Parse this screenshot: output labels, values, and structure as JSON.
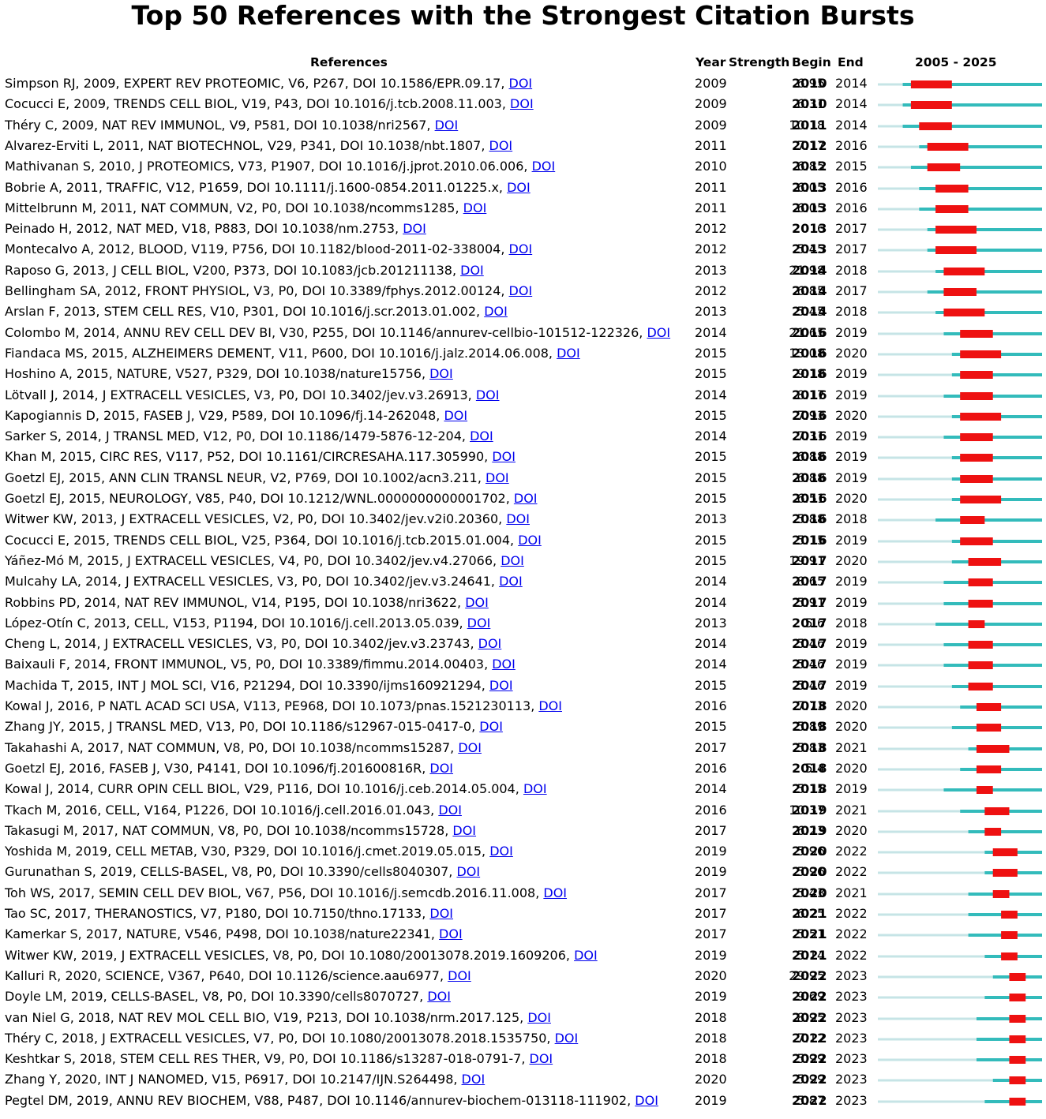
{
  "title": "Top 50 References with the Strongest Citation Bursts",
  "headers": {
    "references": "References",
    "year": "Year",
    "strength": "Strength",
    "begin": "Begin",
    "end": "End",
    "range": "2005 - 2025"
  },
  "colors": {
    "burst": "#ee1111",
    "cited": "#33bbbb",
    "before": "#c6e4e6"
  },
  "chart_data": {
    "type": "table",
    "timeline_range": [
      2005,
      2025
    ],
    "doi_label": "DOI",
    "rows": [
      {
        "ref": "Simpson RJ, 2009, EXPERT REV PROTEOMIC, V6, P267, DOI 10.1586/EPR.09.17, ",
        "year": "2009",
        "strength": "6.95",
        "begin": "2010",
        "end": "2014"
      },
      {
        "ref": "Cocucci E, 2009, TRENDS CELL BIOL, V19, P43, DOI 10.1016/j.tcb.2008.11.003, ",
        "year": "2009",
        "strength": "6.31",
        "begin": "2010",
        "end": "2014"
      },
      {
        "ref": "Théry C, 2009, NAT REV IMMUNOL, V9, P581, DOI 10.1038/nri2567, ",
        "year": "2009",
        "strength": "10.18",
        "begin": "2011",
        "end": "2014"
      },
      {
        "ref": "Alvarez-Erviti L, 2011, NAT BIOTECHNOL, V29, P341, DOI 10.1038/nbt.1807, ",
        "year": "2011",
        "strength": "7.17",
        "begin": "2012",
        "end": "2016"
      },
      {
        "ref": "Mathivanan S, 2010, J PROTEOMICS, V73, P1907, DOI 10.1016/j.jprot.2010.06.006, ",
        "year": "2010",
        "strength": "6.85",
        "begin": "2012",
        "end": "2015"
      },
      {
        "ref": "Bobrie A, 2011, TRAFFIC, V12, P1659, DOI 10.1111/j.1600-0854.2011.01225.x, ",
        "year": "2011",
        "strength": "6.05",
        "begin": "2013",
        "end": "2016"
      },
      {
        "ref": "Mittelbrunn M, 2011, NAT COMMUN, V2, P0, DOI 10.1038/ncomms1285, ",
        "year": "2011",
        "strength": "6.05",
        "begin": "2013",
        "end": "2016"
      },
      {
        "ref": "Peinado H, 2012, NAT MED, V18, P883, DOI 10.1038/nm.2753, ",
        "year": "2012",
        "strength": "6",
        "begin": "2013",
        "end": "2017"
      },
      {
        "ref": "Montecalvo A, 2012, BLOOD, V119, P756, DOI 10.1182/blood-2011-02-338004, ",
        "year": "2012",
        "strength": "5.45",
        "begin": "2013",
        "end": "2017"
      },
      {
        "ref": "Raposo G, 2013, J CELL BIOL, V200, P373, DOI 10.1083/jcb.201211138, ",
        "year": "2013",
        "strength": "21.98",
        "begin": "2014",
        "end": "2018"
      },
      {
        "ref": "Bellingham SA, 2012, FRONT PHYSIOL, V3, P0, DOI 10.3389/fphys.2012.00124, ",
        "year": "2012",
        "strength": "6.85",
        "begin": "2014",
        "end": "2017"
      },
      {
        "ref": "Arslan F, 2013, STEM CELL RES, V10, P301, DOI 10.1016/j.scr.2013.01.002, ",
        "year": "2013",
        "strength": "5.45",
        "begin": "2014",
        "end": "2018"
      },
      {
        "ref": "Colombo M, 2014, ANNU REV CELL DEV BI, V30, P255, DOI 10.1146/annurev-cellbio-101512-122326, ",
        "year": "2014",
        "strength": "21.65",
        "begin": "2016",
        "end": "2019"
      },
      {
        "ref": "Fiandaca MS, 2015, ALZHEIMERS DEMENT, V11, P600, DOI 10.1016/j.jalz.2014.06.008, ",
        "year": "2015",
        "strength": "13.08",
        "begin": "2016",
        "end": "2020"
      },
      {
        "ref": "Hoshino A, 2015, NATURE, V527, P329, DOI 10.1038/nature15756, ",
        "year": "2015",
        "strength": "9.18",
        "begin": "2016",
        "end": "2019"
      },
      {
        "ref": "Lötvall J, 2014, J EXTRACELL VESICLES, V3, P0, DOI 10.3402/jev.v3.26913, ",
        "year": "2014",
        "strength": "8.17",
        "begin": "2016",
        "end": "2019"
      },
      {
        "ref": "Kapogiannis D, 2015, FASEB J, V29, P589, DOI 10.1096/fj.14-262048, ",
        "year": "2015",
        "strength": "7.93",
        "begin": "2016",
        "end": "2020"
      },
      {
        "ref": "Sarker S, 2014, J TRANSL MED, V12, P0, DOI 10.1186/1479-5876-12-204, ",
        "year": "2014",
        "strength": "7.31",
        "begin": "2016",
        "end": "2019"
      },
      {
        "ref": "Khan M, 2015, CIRC RES, V117, P52, DOI 10.1161/CIRCRESAHA.117.305990, ",
        "year": "2015",
        "strength": "6.88",
        "begin": "2016",
        "end": "2019"
      },
      {
        "ref": "Goetzl EJ, 2015, ANN CLIN TRANSL NEUR, V2, P769, DOI 10.1002/acn3.211, ",
        "year": "2015",
        "strength": "6.88",
        "begin": "2016",
        "end": "2019"
      },
      {
        "ref": "Goetzl EJ, 2015, NEUROLOGY, V85, P40, DOI 10.1212/WNL.0000000000001702, ",
        "year": "2015",
        "strength": "6.51",
        "begin": "2016",
        "end": "2020"
      },
      {
        "ref": "Witwer KW, 2013, J EXTRACELL VESICLES, V2, P0, DOI 10.3402/jev.v2i0.20360, ",
        "year": "2013",
        "strength": "5.88",
        "begin": "2016",
        "end": "2018"
      },
      {
        "ref": "Cocucci E, 2015, TRENDS CELL BIOL, V25, P364, DOI 10.1016/j.tcb.2015.01.004, ",
        "year": "2015",
        "strength": "5.15",
        "begin": "2016",
        "end": "2019"
      },
      {
        "ref": "Yáñez-Mó M, 2015, J EXTRACELL VESICLES, V4, P0, DOI 10.3402/jev.v4.27066, ",
        "year": "2015",
        "strength": "19.91",
        "begin": "2017",
        "end": "2020"
      },
      {
        "ref": "Mulcahy LA, 2014, J EXTRACELL VESICLES, V3, P0, DOI 10.3402/jev.v3.24641, ",
        "year": "2014",
        "strength": "8.65",
        "begin": "2017",
        "end": "2019"
      },
      {
        "ref": "Robbins PD, 2014, NAT REV IMMUNOL, V14, P195, DOI 10.1038/nri3622, ",
        "year": "2014",
        "strength": "5.91",
        "begin": "2017",
        "end": "2019"
      },
      {
        "ref": "López-Otín C, 2013, CELL, V153, P1194, DOI 10.1016/j.cell.2013.05.039, ",
        "year": "2013",
        "strength": "5.6",
        "begin": "2017",
        "end": "2018"
      },
      {
        "ref": "Cheng L, 2014, J EXTRACELL VESICLES, V3, P0, DOI 10.3402/jev.v3.23743, ",
        "year": "2014",
        "strength": "5.46",
        "begin": "2017",
        "end": "2019"
      },
      {
        "ref": "Baixauli F, 2014, FRONT IMMUNOL, V5, P0, DOI 10.3389/fimmu.2014.00403, ",
        "year": "2014",
        "strength": "5.46",
        "begin": "2017",
        "end": "2019"
      },
      {
        "ref": "Machida T, 2015, INT J MOL SCI, V16, P21294, DOI 10.3390/ijms160921294, ",
        "year": "2015",
        "strength": "5.46",
        "begin": "2017",
        "end": "2019"
      },
      {
        "ref": "Kowal J, 2016, P NATL ACAD SCI USA, V113, PE968, DOI 10.1073/pnas.1521230113, ",
        "year": "2016",
        "strength": "7.73",
        "begin": "2018",
        "end": "2020"
      },
      {
        "ref": "Zhang JY, 2015, J TRANSL MED, V13, P0, DOI 10.1186/s12967-015-0417-0, ",
        "year": "2015",
        "strength": "5.89",
        "begin": "2018",
        "end": "2020"
      },
      {
        "ref": "Takahashi A, 2017, NAT COMMUN, V8, P0, DOI 10.1038/ncomms15287, ",
        "year": "2017",
        "strength": "5.83",
        "begin": "2018",
        "end": "2021"
      },
      {
        "ref": "Goetzl EJ, 2016, FASEB J, V30, P4141, DOI 10.1096/fj.201600816R, ",
        "year": "2016",
        "strength": "5.4",
        "begin": "2018",
        "end": "2020"
      },
      {
        "ref": "Kowal J, 2014, CURR OPIN CELL BIOL, V29, P116, DOI 10.1016/j.ceb.2014.05.004, ",
        "year": "2014",
        "strength": "5.15",
        "begin": "2018",
        "end": "2019"
      },
      {
        "ref": "Tkach M, 2016, CELL, V164, P1226, DOI 10.1016/j.cell.2016.01.043, ",
        "year": "2016",
        "strength": "10.37",
        "begin": "2019",
        "end": "2021"
      },
      {
        "ref": "Takasugi M, 2017, NAT COMMUN, V8, P0, DOI 10.1038/ncomms15728, ",
        "year": "2017",
        "strength": "6.23",
        "begin": "2019",
        "end": "2020"
      },
      {
        "ref": "Yoshida M, 2019, CELL METAB, V30, P329, DOI 10.1016/j.cmet.2019.05.015, ",
        "year": "2019",
        "strength": "5.96",
        "begin": "2020",
        "end": "2022"
      },
      {
        "ref": "Gurunathan S, 2019, CELLS-BASEL, V8, P0, DOI 10.3390/cells8040307, ",
        "year": "2019",
        "strength": "5.96",
        "begin": "2020",
        "end": "2022"
      },
      {
        "ref": "Toh WS, 2017, SEMIN CELL DEV BIOL, V67, P56, DOI 10.1016/j.semcdb.2016.11.008, ",
        "year": "2017",
        "strength": "5.43",
        "begin": "2020",
        "end": "2021"
      },
      {
        "ref": "Tao SC, 2017, THERANOSTICS, V7, P180, DOI 10.7150/thno.17133, ",
        "year": "2017",
        "strength": "6.25",
        "begin": "2021",
        "end": "2022"
      },
      {
        "ref": "Kamerkar S, 2017, NATURE, V546, P498, DOI 10.1038/nature22341, ",
        "year": "2017",
        "strength": "5.51",
        "begin": "2021",
        "end": "2022"
      },
      {
        "ref": "Witwer KW, 2019, J EXTRACELL VESICLES, V8, P0, DOI 10.1080/20013078.2019.1609206, ",
        "year": "2019",
        "strength": "5.14",
        "begin": "2021",
        "end": "2022"
      },
      {
        "ref": "Kalluri R, 2020, SCIENCE, V367, P640, DOI 10.1126/science.aau6977, ",
        "year": "2020",
        "strength": "29.95",
        "begin": "2022",
        "end": "2023"
      },
      {
        "ref": "Doyle LM, 2019, CELLS-BASEL, V8, P0, DOI 10.3390/cells8070727, ",
        "year": "2019",
        "strength": "9.69",
        "begin": "2022",
        "end": "2023"
      },
      {
        "ref": "van Niel G, 2018, NAT REV MOL CELL BIO, V19, P213, DOI 10.1038/nrm.2017.125, ",
        "year": "2018",
        "strength": "8.95",
        "begin": "2022",
        "end": "2023"
      },
      {
        "ref": "Théry C, 2018, J EXTRACELL VESICLES, V7, P0, DOI 10.1080/20013078.2018.1535750, ",
        "year": "2018",
        "strength": "7.12",
        "begin": "2022",
        "end": "2023"
      },
      {
        "ref": "Keshtkar S, 2018, STEM CELL RES THER, V9, P0, DOI 10.1186/s13287-018-0791-7, ",
        "year": "2018",
        "strength": "5.99",
        "begin": "2022",
        "end": "2023"
      },
      {
        "ref": "Zhang Y, 2020, INT J NANOMED, V15, P6917, DOI 10.2147/IJN.S264498, ",
        "year": "2020",
        "strength": "5.99",
        "begin": "2022",
        "end": "2023"
      },
      {
        "ref": "Pegtel DM, 2019, ANNU REV BIOCHEM, V88, P487, DOI 10.1146/annurev-biochem-013118-111902, ",
        "year": "2019",
        "strength": "5.87",
        "begin": "2022",
        "end": "2023"
      }
    ]
  }
}
